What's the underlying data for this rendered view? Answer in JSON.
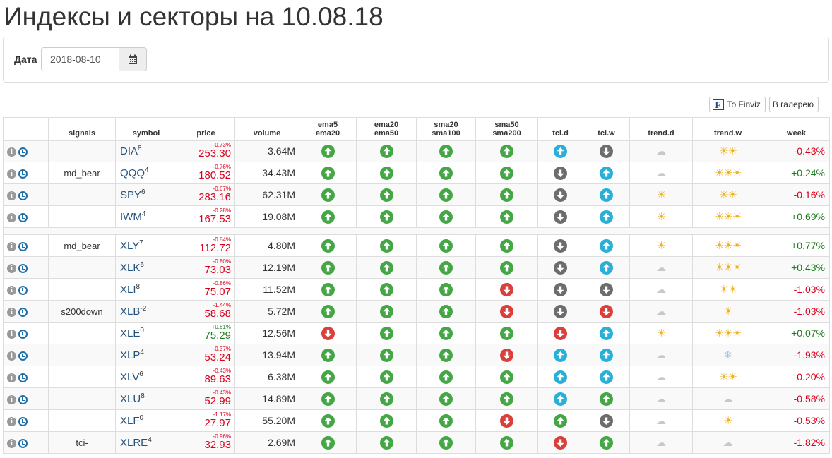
{
  "title": "Индексы и секторы на 10.08.18",
  "date_form": {
    "label": "Дата",
    "value": "2018-08-10"
  },
  "tools": {
    "finviz_icon": "F",
    "finviz_label": "To Finviz",
    "gallery_label": "В галерею"
  },
  "columns": {
    "signals": "signals",
    "symbol": "symbol",
    "price": "price",
    "volume": "volume",
    "ema5": "ema5",
    "ema20a": "ema20",
    "ema20b": "ema20",
    "ema50": "ema50",
    "sma20": "sma20",
    "sma100": "sma100",
    "sma50": "sma50",
    "sma200": "sma200",
    "tcid": "tci.d",
    "tciw": "tci.w",
    "trendd": "trend.d",
    "trendw": "trend.w",
    "week": "week"
  },
  "row_icons": [
    "info-icon",
    "clock-icon"
  ],
  "colors": {
    "green": "#44a645",
    "red": "#d9403c",
    "blue": "#2ab0d8",
    "gray": "#6d6d6d",
    "neg": "#d9001b",
    "pos": "#1a7c1a",
    "link": "#23527c"
  },
  "rows": [
    {
      "signals": "",
      "symbol": "DIA",
      "sup": "8",
      "change": "-0.73%",
      "price": "253.30",
      "volume": "3.64M",
      "a": [
        "g",
        "g",
        "g",
        "g",
        "b",
        "k"
      ],
      "trend_d": "cloud",
      "trend_w": "sun2",
      "week": "-0.43%"
    },
    {
      "signals": "md_bear",
      "symbol": "QQQ",
      "sup": "4",
      "change": "-0.76%",
      "price": "180.52",
      "volume": "34.43M",
      "a": [
        "g",
        "g",
        "g",
        "g",
        "k",
        "b"
      ],
      "trend_d": "cloud",
      "trend_w": "sun3",
      "week": "+0.24%"
    },
    {
      "signals": "",
      "symbol": "SPY",
      "sup": "6",
      "change": "-0.67%",
      "price": "283.16",
      "volume": "62.31M",
      "a": [
        "g",
        "g",
        "g",
        "g",
        "k",
        "b"
      ],
      "trend_d": "sun1",
      "trend_w": "sun2",
      "week": "-0.16%"
    },
    {
      "signals": "",
      "symbol": "IWM",
      "sup": "4",
      "change": "-0.28%",
      "price": "167.53",
      "volume": "19.08M",
      "a": [
        "g",
        "g",
        "g",
        "g",
        "k",
        "b"
      ],
      "trend_d": "sun1",
      "trend_w": "sun3",
      "week": "+0.69%"
    },
    {
      "spacer": true
    },
    {
      "signals": "md_bear",
      "symbol": "XLY",
      "sup": "7",
      "change": "-0.84%",
      "price": "112.72",
      "volume": "4.80M",
      "a": [
        "g",
        "g",
        "g",
        "g",
        "k",
        "b"
      ],
      "trend_d": "sun1",
      "trend_w": "sun3",
      "week": "+0.77%"
    },
    {
      "signals": "",
      "symbol": "XLK",
      "sup": "6",
      "change": "-0.80%",
      "price": "73.03",
      "volume": "12.19M",
      "a": [
        "g",
        "g",
        "g",
        "g",
        "k",
        "b"
      ],
      "trend_d": "cloud",
      "trend_w": "sun3",
      "week": "+0.43%"
    },
    {
      "signals": "",
      "symbol": "XLI",
      "sup": "8",
      "change": "-0.86%",
      "price": "75.07",
      "volume": "11.52M",
      "a": [
        "g",
        "g",
        "g",
        "r",
        "k",
        "k"
      ],
      "trend_d": "cloud",
      "trend_w": "sun2",
      "week": "-1.03%"
    },
    {
      "signals": "s200down",
      "symbol": "XLB",
      "sup": "-2",
      "change": "-1.44%",
      "price": "58.68",
      "volume": "5.72M",
      "a": [
        "g",
        "g",
        "g",
        "r",
        "k",
        "r"
      ],
      "trend_d": "cloud",
      "trend_w": "sun1",
      "week": "-1.03%"
    },
    {
      "signals": "",
      "symbol": "XLE",
      "sup": "0",
      "change": "+0.61%",
      "price": "75.29",
      "volume": "12.56M",
      "a": [
        "r",
        "g",
        "g",
        "g",
        "r",
        "b"
      ],
      "trend_d": "sun1",
      "trend_w": "sun3",
      "week": "+0.07%"
    },
    {
      "signals": "",
      "symbol": "XLP",
      "sup": "4",
      "change": "-0.37%",
      "price": "53.24",
      "volume": "13.94M",
      "a": [
        "g",
        "g",
        "g",
        "r",
        "b",
        "b"
      ],
      "trend_d": "cloud",
      "trend_w": "snow",
      "week": "-1.93%"
    },
    {
      "signals": "",
      "symbol": "XLV",
      "sup": "6",
      "change": "-0.43%",
      "price": "89.63",
      "volume": "6.38M",
      "a": [
        "g",
        "g",
        "g",
        "g",
        "b",
        "b"
      ],
      "trend_d": "cloud",
      "trend_w": "sun2",
      "week": "-0.20%"
    },
    {
      "signals": "",
      "symbol": "XLU",
      "sup": "8",
      "change": "-0.43%",
      "price": "52.99",
      "volume": "14.89M",
      "a": [
        "g",
        "g",
        "g",
        "g",
        "b",
        "g"
      ],
      "trend_d": "cloud",
      "trend_w": "cloud",
      "week": "-0.58%"
    },
    {
      "signals": "",
      "symbol": "XLF",
      "sup": "0",
      "change": "-1.17%",
      "price": "27.97",
      "volume": "55.20M",
      "a": [
        "g",
        "g",
        "g",
        "r",
        "g",
        "k"
      ],
      "trend_d": "cloud",
      "trend_w": "sun1",
      "week": "-0.53%"
    },
    {
      "signals": "tci-",
      "symbol": "XLRE",
      "sup": "4",
      "change": "-0.96%",
      "price": "32.93",
      "volume": "2.69M",
      "a": [
        "g",
        "g",
        "g",
        "g",
        "r",
        "g"
      ],
      "trend_d": "cloud",
      "trend_w": "cloud",
      "week": "-1.82%"
    }
  ]
}
